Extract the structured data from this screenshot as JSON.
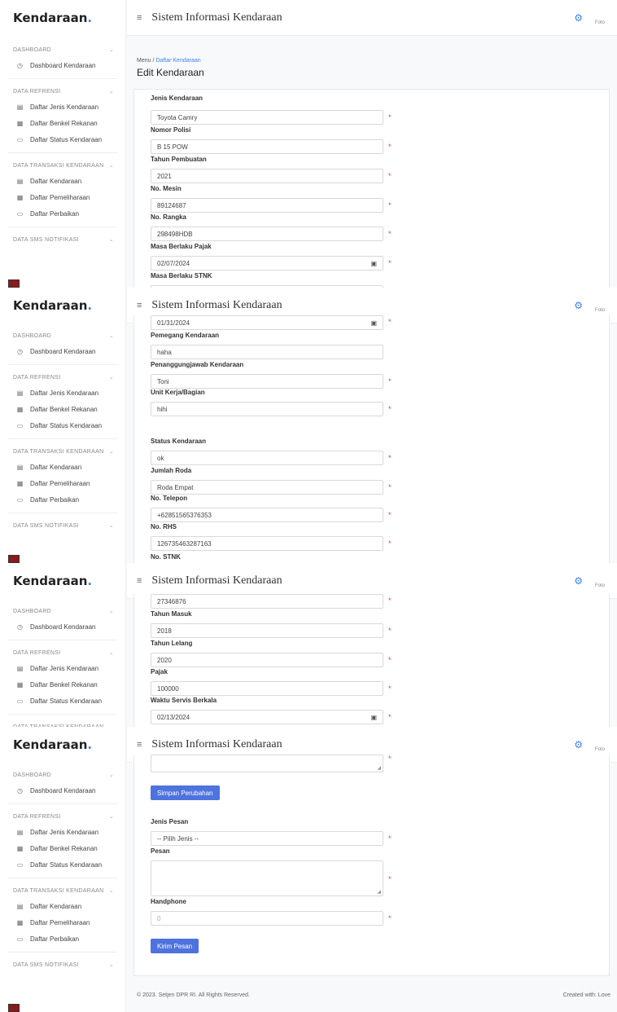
{
  "sidebar": {
    "brand": "Kendaraan",
    "brand_dot": ".",
    "sections": [
      {
        "label": "DASHBOARD",
        "items": [
          {
            "label": "Dashboard Kendaraan",
            "icon": "clock-icon"
          }
        ]
      },
      {
        "label": "DATA REFRENSI",
        "items": [
          {
            "label": "Daftar Jenis Kendaraan",
            "icon": "table-icon"
          },
          {
            "label": "Daftar Benkel Rekanan",
            "icon": "calendar-icon"
          },
          {
            "label": "Daftar Status Kendaraan",
            "icon": "monitor-icon"
          }
        ]
      },
      {
        "label": "DATA TRANSAKSI KENDARAAN",
        "items": [
          {
            "label": "Daftar Kendaraan",
            "icon": "table-icon"
          },
          {
            "label": "Daftar Pemeliharaan",
            "icon": "calendar-icon"
          },
          {
            "label": "Daftar Perbaikan",
            "icon": "monitor-icon"
          }
        ]
      },
      {
        "label": "DATA SMS NOTIFIKASI",
        "items": []
      }
    ]
  },
  "topbar": {
    "title": "Sistem Informasi Kendaraan",
    "avatar_alt": "Foto"
  },
  "breadcrumb": {
    "root": "Menu",
    "sep": "/",
    "current": "Daftar Kendaraan"
  },
  "page_title": "Edit Kendaraan",
  "form": {
    "jenis_label": "Jenis Kendaraan",
    "jenis_value": "Toyota Camry",
    "nopol_label": "Nomor Polisi",
    "nopol_value": "B 15 POW",
    "tahun_label": "Tahun Pembuatan",
    "tahun_value": "2021",
    "mesin_label": "No. Mesin",
    "mesin_value": "89124687",
    "rangka_label": "No. Rangka",
    "rangka_value": "298498HDB",
    "pajak_berlaku_label": "Masa Berlaku Pajak",
    "pajak_berlaku_value": "02/07/2024",
    "stnk_berlaku_label": "Masa Berlaku STNK",
    "stnk_berlaku_value": "01/31/2024",
    "pemegang_label": "Pemegang Kendaraan",
    "pemegang_value": "haha",
    "pj_label": "Penanggungjawab Kendaraan",
    "pj_value": "Toni",
    "unit_label": "Unit Kerja/Bagian",
    "unit_value": "hihi",
    "status_label": "Status Kendaraan",
    "status_value": "ok",
    "roda_label": "Jumlah Roda",
    "roda_value": "Roda Empat",
    "telp_label": "No. Telepon",
    "telp_value": "+62851565376353",
    "rhs_label": "No. RHS",
    "rhs_value": "126735463287163",
    "stnk_label": "No. STNK",
    "stnk_value": "27346876",
    "masuk_label": "Tahun Masuk",
    "masuk_value": "2018",
    "lelang_label": "Tahun Lelang",
    "lelang_value": "2020",
    "pajak_label": "Pajak",
    "pajak_value": "100000",
    "servis_label": "Waktu Servis Berkala",
    "servis_value": "02/13/2024",
    "save_button": "Simpan Perubahan"
  },
  "sms": {
    "jenis_label": "Jenis Pesan",
    "jenis_value": "-- Pilih Jenis --",
    "pesan_label": "Pesan",
    "hp_label": "Handphone",
    "hp_placeholder": "0",
    "send_button": "Kirim Pesan"
  },
  "footer": {
    "copyright": "© 2023. Setjen DPR RI. All Rights Reserved.",
    "credit": "Created with: Love"
  },
  "glyphs": {
    "req": "*",
    "calendar": "▣",
    "burger": "≡",
    "gear": "⚙",
    "chev": "⌄",
    "grip": "◢"
  },
  "colors": {
    "accent": "#4e73df",
    "required": "#e03b3b",
    "brand_dot": "#3b82f6"
  }
}
